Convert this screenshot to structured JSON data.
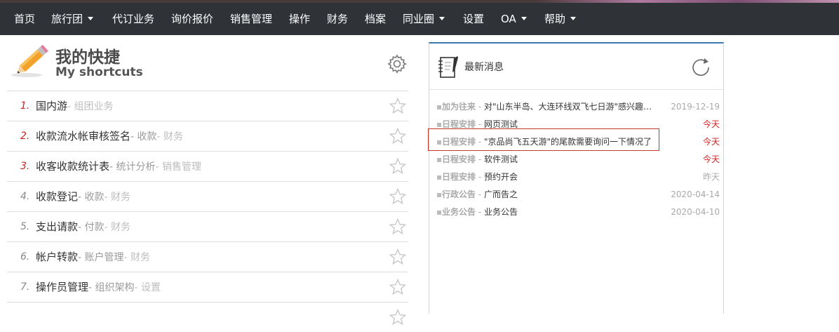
{
  "nav": {
    "items": [
      {
        "label": "首页",
        "dropdown": false
      },
      {
        "label": "旅行团",
        "dropdown": true
      },
      {
        "label": "代订业务",
        "dropdown": false
      },
      {
        "label": "询价报价",
        "dropdown": false
      },
      {
        "label": "销售管理",
        "dropdown": false
      },
      {
        "label": "操作",
        "dropdown": false
      },
      {
        "label": "财务",
        "dropdown": false
      },
      {
        "label": "档案",
        "dropdown": false
      },
      {
        "label": "同业圈",
        "dropdown": true
      },
      {
        "label": "设置",
        "dropdown": false
      },
      {
        "label": "OA",
        "dropdown": true
      },
      {
        "label": "帮助",
        "dropdown": true
      }
    ]
  },
  "shortcuts": {
    "title": "我的快捷",
    "subtitle": "My shortcuts",
    "items": [
      {
        "num": "1.",
        "title": "国内游",
        "cat1": "",
        "cat2": "- 组团业务"
      },
      {
        "num": "2.",
        "title": "收款流水帐审核签名",
        "cat1": "- 收款",
        "cat2": "- 财务"
      },
      {
        "num": "3.",
        "title": "收客收款统计表",
        "cat1": "- 统计分析",
        "cat2": "- 销售管理"
      },
      {
        "num": "4.",
        "title": "收款登记",
        "cat1": "- 收款",
        "cat2": "- 财务"
      },
      {
        "num": "5.",
        "title": "支出请款",
        "cat1": "- 付款",
        "cat2": "- 财务"
      },
      {
        "num": "6.",
        "title": "帐户转款",
        "cat1": "- 账户管理",
        "cat2": "- 财务"
      },
      {
        "num": "7.",
        "title": "操作员管理",
        "cat1": "- 组织架构",
        "cat2": "- 设置"
      }
    ]
  },
  "news": {
    "title": "最新消息",
    "items": [
      {
        "cat": "加为往来",
        "text": "对\"山东半岛、大连环线双飞七日游\"感兴趣，请与我联系",
        "date": "2019-12-19",
        "today": false
      },
      {
        "cat": "日程安排",
        "text": "网页测试",
        "date": "今天",
        "today": true
      },
      {
        "cat": "日程安排",
        "text": "\"京品尚飞五天游\"的尾款需要询问一下情况了",
        "date": "今天",
        "today": true
      },
      {
        "cat": "日程安排",
        "text": "软件测试",
        "date": "今天",
        "today": true
      },
      {
        "cat": "日程安排",
        "text": "预约开会",
        "date": "昨天",
        "today": false
      },
      {
        "cat": "行政公告",
        "text": "广而告之",
        "date": "2020-04-14",
        "today": false
      },
      {
        "cat": "业务公告",
        "text": "业务公告",
        "date": "2020-04-10",
        "today": false
      }
    ]
  },
  "colors": {
    "navbar": "#2f3338",
    "accent_red": "#d9201f",
    "num_red": "#cc2222",
    "num_gray": "#888888",
    "highlight_border": "#c0392b"
  }
}
